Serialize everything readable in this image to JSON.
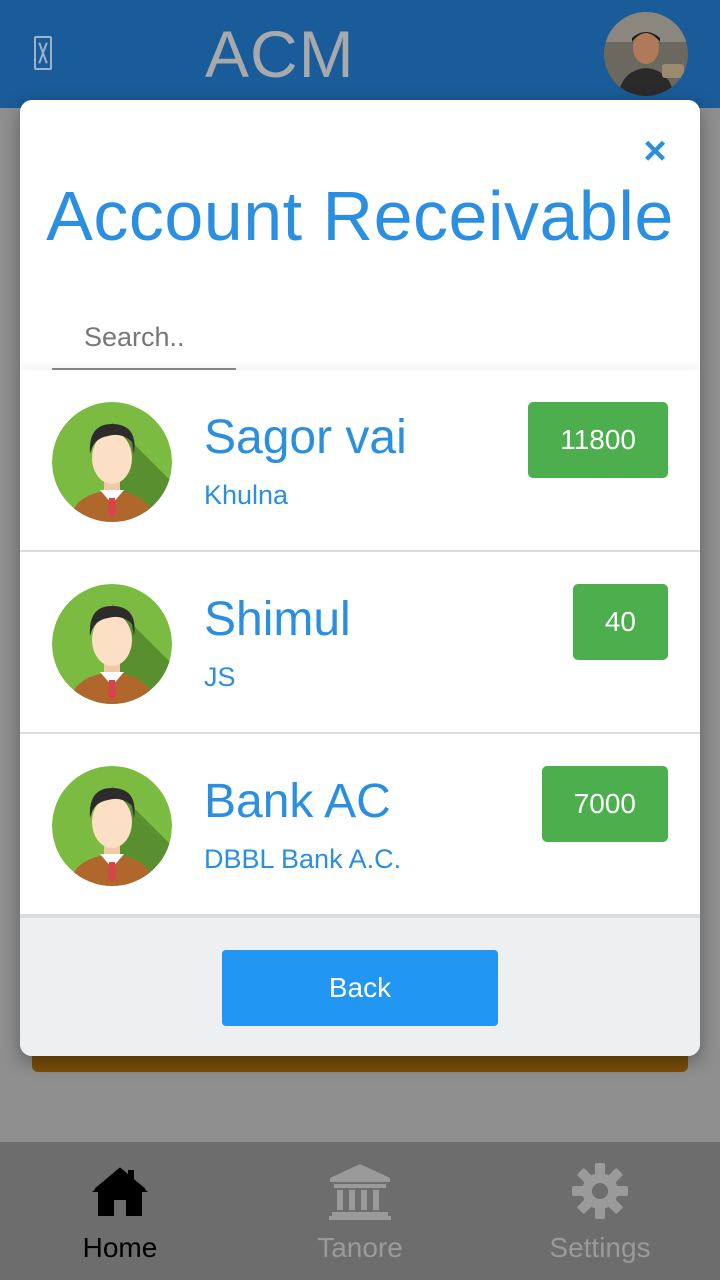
{
  "app": {
    "title": "ACM",
    "menu_icon": "menu-icon",
    "profile_icon": "user-avatar-photo"
  },
  "modal": {
    "title": "Account Receivable",
    "close_label": "×",
    "search": {
      "placeholder": "Search..",
      "value": ""
    },
    "back_label": "Back"
  },
  "accounts": [
    {
      "name": "Sagor vai",
      "subtitle": "Khulna",
      "amount": "11800",
      "avatar_icon": "person-avatar-icon"
    },
    {
      "name": "Shimul",
      "subtitle": "JS",
      "amount": "40",
      "avatar_icon": "person-avatar-icon"
    },
    {
      "name": "Bank AC",
      "subtitle": "DBBL Bank A.C.",
      "amount": "7000",
      "avatar_icon": "person-avatar-icon"
    }
  ],
  "bottom_nav": {
    "items": [
      {
        "label": "Home",
        "icon": "home-icon",
        "active": true
      },
      {
        "label": "Tanore",
        "icon": "bank-icon",
        "active": false
      },
      {
        "label": "Settings",
        "icon": "gear-icon",
        "active": false
      }
    ]
  },
  "colors": {
    "header": "#1a5c99",
    "accent": "#2a8fe0",
    "badge": "#4cae4c",
    "back_button": "#2196f3"
  }
}
